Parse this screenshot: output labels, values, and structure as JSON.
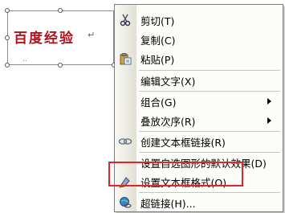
{
  "textbox": {
    "text": "百度经验",
    "return_mark": "↵",
    "dots": ".."
  },
  "menu": {
    "items": [
      {
        "label": "剪切(T)",
        "icon": "scissors-icon"
      },
      {
        "label": "复制(C)",
        "icon": "copy-icon"
      },
      {
        "label": "粘贴(P)",
        "icon": "paste-icon"
      },
      {
        "label": "编辑文字(X)"
      },
      {
        "label": "组合(G)",
        "submenu": true
      },
      {
        "label": "叠放次序(R)",
        "submenu": true
      },
      {
        "label": "创建文本框链接(R)",
        "icon": "link-icon"
      },
      {
        "label": "设置自选图形的默认效果(D)"
      },
      {
        "label": "设置文本框格式(O)...",
        "icon": "format-textbox-icon"
      },
      {
        "label": "超链接(H)...",
        "icon": "hyperlink-icon"
      }
    ]
  },
  "colors": {
    "text_red": "#b0141b",
    "highlight": "#e0262c"
  }
}
